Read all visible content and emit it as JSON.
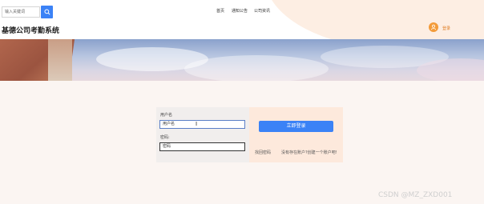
{
  "search": {
    "placeholder": "输入关键词"
  },
  "nav": {
    "items": [
      "首页",
      "通知公告",
      "公司资讯"
    ]
  },
  "site": {
    "title": "基德公司考勤系统"
  },
  "account": {
    "login_label": "登录"
  },
  "login_form": {
    "username_label": "用户名",
    "username_value": "用户名",
    "password_label": "密码:",
    "password_value": "密码",
    "submit_label": "立即登录",
    "forgot_label": "找回密码",
    "register_prompt": "没有存在账户?创建一个账户吧!"
  },
  "watermark": {
    "text": "CSDN @MZ_ZXD001"
  },
  "colors": {
    "accent": "#3b82f6",
    "avatar": "#f39b3a",
    "peach": "#fdeee3",
    "page_bg": "#fbf5f2"
  }
}
